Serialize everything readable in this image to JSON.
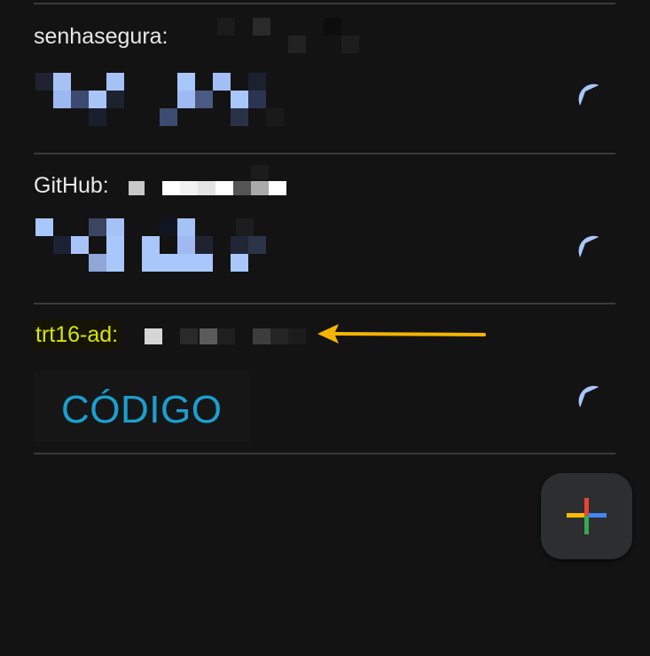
{
  "accounts": [
    {
      "label": "senhasegura:",
      "code": "",
      "highlighted": false
    },
    {
      "label": "GitHub:",
      "code": "",
      "highlighted": false
    },
    {
      "label": "trt16-ad:",
      "code": "CÓDIGO",
      "highlighted": true
    }
  ],
  "fab": {
    "icon": "plus-icon"
  },
  "annotation": {
    "icon": "arrow-left-icon",
    "color": "#f5b400"
  },
  "colors": {
    "background": "#131313",
    "divider": "#3a3a3a",
    "code_accent": "#1aa0d0",
    "timer": "#a8c7fa",
    "highlight_text": "#d8e600"
  }
}
